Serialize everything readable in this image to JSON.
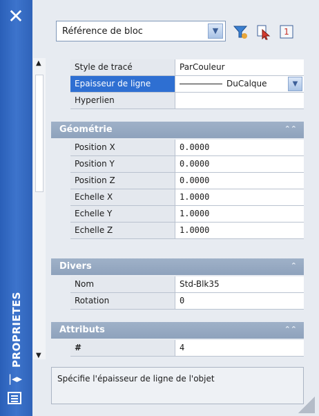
{
  "palette": {
    "title_strip": "#3d74cc",
    "selected_row": "#2e6fd2",
    "section_header": "#9fb1c8"
  },
  "window": {
    "close_icon": "close-icon",
    "vertical_title": "PROPRIETES"
  },
  "toolbar": {
    "object_type": "Référence de bloc"
  },
  "general": [
    {
      "key": "Style de tracé",
      "value": "ParCouleur"
    },
    {
      "key": "Epaisseur de ligne",
      "value": "DuCalque"
    },
    {
      "key": "Hyperlien",
      "value": ""
    }
  ],
  "sections": {
    "geometrie": {
      "title": "Géométrie",
      "rows": [
        {
          "key": "Position X",
          "value": "0.0000"
        },
        {
          "key": "Position Y",
          "value": "0.0000"
        },
        {
          "key": "Position Z",
          "value": "0.0000"
        },
        {
          "key": "Echelle X",
          "value": "1.0000"
        },
        {
          "key": "Echelle Y",
          "value": "1.0000"
        },
        {
          "key": "Echelle Z",
          "value": "1.0000"
        }
      ]
    },
    "divers": {
      "title": "Divers",
      "rows": [
        {
          "key": "Nom",
          "value": "Std-Blk35"
        },
        {
          "key": "Rotation",
          "value": "0"
        }
      ]
    },
    "attributs": {
      "title": "Attributs",
      "rows": [
        {
          "key": "#",
          "value": "4"
        }
      ]
    }
  },
  "description": "Spécifie l'épaisseur de ligne de l'objet"
}
